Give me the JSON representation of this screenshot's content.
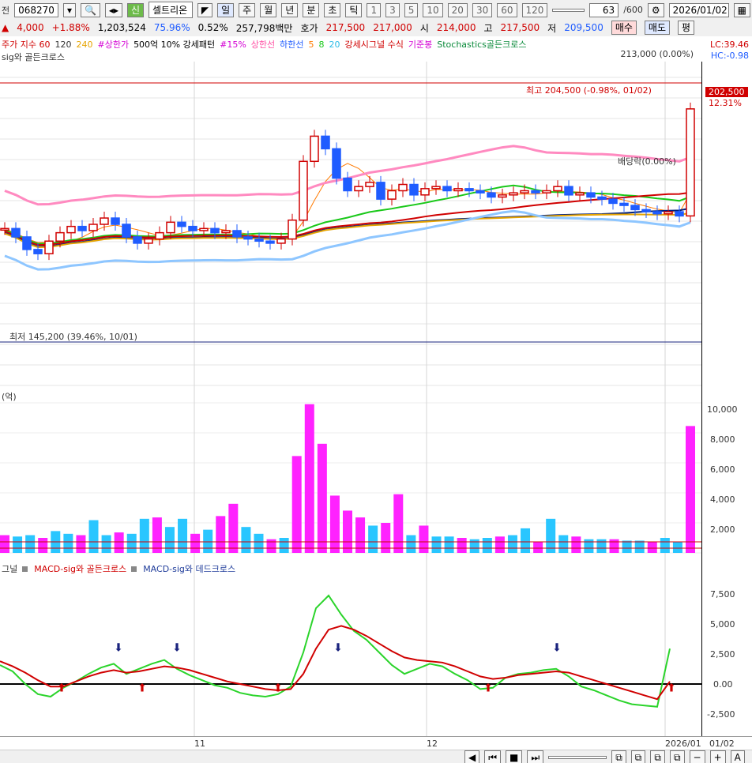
{
  "toolbar": {
    "left_label": "전",
    "code": "068270",
    "name_badge": "신",
    "name": "셀트리온",
    "periods": [
      "일",
      "주",
      "월",
      "년",
      "분",
      "초",
      "틱"
    ],
    "active_period": "일",
    "minute_options": [
      "1",
      "3",
      "5",
      "10",
      "20",
      "30",
      "60",
      "120"
    ],
    "count_value": "63",
    "count_total": "/600",
    "date": "2026/01/02",
    "buy_label": "매수",
    "sell_label": "매도",
    "extra_label": "평"
  },
  "quote": {
    "change": "4,000",
    "change_pct": "+1.88%",
    "volume": "1,203,524",
    "ratio1": "75.96%",
    "ratio2": "0.52%",
    "turnover": "257,798백만",
    "ask_label": "호가",
    "ask1": "217,500",
    "ask2": "217,000",
    "open_label": "시",
    "open": "214,000",
    "high_label": "고",
    "high": "217,500",
    "low_label": "저",
    "low": "209,500"
  },
  "indicator_legend": {
    "items": [
      "주가 지수 60",
      "120",
      "240",
      "#상한가",
      "500억 10% 강세패턴",
      "#15%",
      "상한선",
      "하한선",
      "5",
      "8",
      "20",
      "강세시그널 수식",
      "기준봉",
      "Stochastics골든크로스"
    ],
    "lc": "LC:39.46",
    "hc": "HC:-0.98",
    "subtitle": "sig와 골든크로스",
    "price_tag": "213,000 (0.00%)"
  },
  "price_panel": {
    "high_note": "최고 204,500 (-0.98%, 01/02)",
    "low_note": "최저 145,200 (39.46%, 10/01)",
    "dividend_note": "배당락(0.00%)",
    "last_price": "202,500",
    "last_pct": "12.31%"
  },
  "volume_panel": {
    "title": "(억)",
    "y_ticks": [
      "10,000",
      "8,000",
      "6,000",
      "4,000",
      "2,000"
    ]
  },
  "macd_panel": {
    "legend": [
      "그널",
      "MACD-sig와 골든크로스",
      "MACD-sig와 데드크로스"
    ],
    "y_ticks": [
      "7,500",
      "5,000",
      "2,500",
      "0.00",
      "-2,500"
    ]
  },
  "x_axis": {
    "labels": [
      "11",
      "12",
      "2026/01",
      "01/02"
    ]
  },
  "chart_data": [
    {
      "type": "candlestick",
      "ylim": [
        140000,
        210000
      ],
      "series": [
        {
          "name": "5",
          "color": "#ff7a00"
        },
        {
          "name": "20",
          "color": "#19c819"
        },
        {
          "name": "60",
          "color": "#d00000"
        },
        {
          "name": "120",
          "color": "#00207f"
        },
        {
          "name": "240",
          "color": "#e6a400"
        },
        {
          "name": "상한선",
          "color": "#ff8ac0"
        },
        {
          "name": "하한선",
          "color": "#8ec6ff"
        }
      ],
      "close": [
        174000,
        172000,
        169000,
        168000,
        171000,
        173000,
        174500,
        173500,
        175000,
        176500,
        175000,
        172000,
        170500,
        171500,
        173000,
        175500,
        174500,
        173500,
        174000,
        173000,
        173500,
        172000,
        171500,
        171000,
        170500,
        171500,
        176000,
        190000,
        196000,
        193000,
        186000,
        183000,
        184000,
        185000,
        181000,
        183000,
        184500,
        182000,
        183500,
        184000,
        183000,
        183500,
        183000,
        182500,
        181500,
        182000,
        182500,
        183000,
        182500,
        183000,
        184000,
        182000,
        182500,
        181500,
        181000,
        180000,
        179500,
        178500,
        178000,
        177500,
        178000,
        177000,
        202500
      ],
      "volume": [
        1300,
        1200,
        1300,
        1100,
        1600,
        1400,
        1300,
        2400,
        1300,
        1500,
        1400,
        2500,
        2600,
        1900,
        2500,
        1400,
        1700,
        2700,
        3600,
        1900,
        1400,
        1000,
        1100,
        7100,
        10900,
        8000,
        4200,
        3100,
        2600,
        2000,
        2200,
        4300,
        1300,
        2000,
        1200,
        1200,
        1100,
        1000,
        1100,
        1200,
        1300,
        1800,
        800,
        2500,
        1300,
        1200,
        1000,
        1000,
        1000,
        900,
        900,
        800,
        1100,
        800,
        9300
      ],
      "volume_unit": "억"
    },
    {
      "type": "line",
      "title": "MACD",
      "ylim": [
        -3500,
        8500
      ],
      "series": [
        {
          "name": "MACD",
          "color": "#2bd42b",
          "values": [
            1500,
            1000,
            0,
            -800,
            -1000,
            -300,
            200,
            800,
            1300,
            1600,
            800,
            1200,
            1600,
            1900,
            1200,
            700,
            300,
            -100,
            -300,
            -700,
            -900,
            -1000,
            -800,
            -200,
            2500,
            6000,
            7000,
            5500,
            4200,
            3500,
            2500,
            1500,
            800,
            1200,
            1600,
            1400,
            800,
            300,
            -400,
            -300,
            500,
            800,
            900,
            1100,
            1200,
            600,
            -200,
            -500,
            -900,
            -1300,
            -1600,
            -1700,
            -1800,
            2800
          ]
        },
        {
          "name": "Signal",
          "color": "#d00000",
          "values": [
            1800,
            1400,
            900,
            300,
            -200,
            -200,
            200,
            600,
            900,
            1100,
            900,
            1000,
            1200,
            1400,
            1300,
            1100,
            800,
            500,
            200,
            0,
            -200,
            -400,
            -500,
            -400,
            800,
            2800,
            4300,
            4600,
            4300,
            3800,
            3200,
            2600,
            2100,
            1900,
            1800,
            1700,
            1400,
            1000,
            600,
            400,
            500,
            700,
            800,
            900,
            1000,
            900,
            600,
            300,
            0,
            -300,
            -600,
            -900,
            -1200,
            200
          ]
        }
      ]
    }
  ]
}
